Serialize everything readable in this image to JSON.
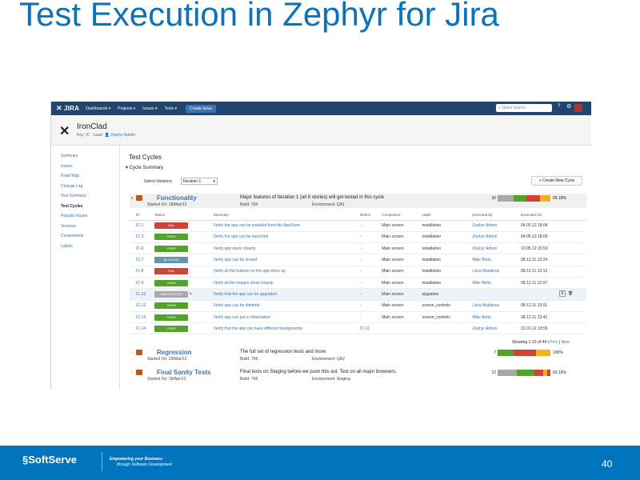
{
  "slide": {
    "title": "Test Execution in Zephyr for Jira",
    "page_number": "40"
  },
  "jira": {
    "logo": "JIRA",
    "nav": [
      "Dashboards ▾",
      "Projects ▾",
      "Issues ▾",
      "Tests ▾"
    ],
    "create_label": "Create issue",
    "search_placeholder": "Quick Search",
    "help_icon": "?",
    "gear_icon": "⚙"
  },
  "project": {
    "name": "IronClad",
    "key_label": "Key: IC",
    "lead_label": "Lead:",
    "lead_name": "Zephyr Admin"
  },
  "sidebar": {
    "items": [
      "Summary",
      "Issues",
      "Road Map",
      "Change Log",
      "Test Summary",
      "Test Cycles",
      "Popular Issues",
      "Versions",
      "Components",
      "Labels"
    ],
    "active_index": 5
  },
  "main": {
    "title": "Test Cycles",
    "section": "Cycle Summary",
    "select_label": "Select Versions:",
    "select_value": "Iteration 1",
    "new_cycle_label": "+ Create New Cycle"
  },
  "cycles": [
    {
      "name": "Functionality",
      "started": "Started On: 18/Mar/12",
      "build": "Build: 766",
      "environment": "Environment: QA1",
      "description": "Major features of Iteration 1 (all 8 stories) will get tested in this cycle",
      "count": "30",
      "percent": "68.18%",
      "segments": [
        {
          "color": "#a9a9a9",
          "value": 0.3
        },
        {
          "color": "#52a32c",
          "value": 0.25
        },
        {
          "color": "#d04437",
          "value": 0.25
        },
        {
          "color": "#f0b31e",
          "value": 0.2
        }
      ]
    },
    {
      "name": "Regression",
      "started": "Started On: 23/Mar/12",
      "build": "Build: 766",
      "environment": "Environment: QA2",
      "description": "The full set of regression tests and more",
      "count": "7",
      "percent": "100%",
      "segments": [
        {
          "color": "#52a32c",
          "value": 0.3
        },
        {
          "color": "#d04437",
          "value": 0.42
        },
        {
          "color": "#f0b31e",
          "value": 0.28
        }
      ]
    },
    {
      "name": "Final Sanity Tests",
      "started": "Started On: 18/Apr/12",
      "build": "Build: 766",
      "environment": "Environment: Staging",
      "description": "Final tests on Staging before we push this out. Test on all major browsers.",
      "count": "12",
      "percent": "63.16%",
      "segments": [
        {
          "color": "#a9a9a9",
          "value": 0.36
        },
        {
          "color": "#52a32c",
          "value": 0.34
        },
        {
          "color": "#d04437",
          "value": 0.16
        },
        {
          "color": "#f0b31e",
          "value": 0.08
        },
        {
          "color": "#d04437",
          "value": 0.06
        }
      ]
    }
  ],
  "executions": {
    "headers": [
      "ID",
      "Status",
      "Summary",
      "Defect",
      "Component",
      "Label",
      "Executed By",
      "Executed On"
    ],
    "rows": [
      {
        "id": "IC-1",
        "status": "FAIL",
        "color": "#d04437",
        "summary": "Verify the app can be installed from the AppStore",
        "defect": "-",
        "component": "Main screen",
        "label": "installation",
        "by": "Zephyr Admin",
        "on": "04.05.12 18:04"
      },
      {
        "id": "IC-3",
        "status": "PASS",
        "color": "#52a32c",
        "summary": "Verify the app can be launched",
        "defect": "-",
        "component": "Main screen",
        "label": "installation",
        "by": "Zephyr Admin",
        "on": "04.05.12 18:05"
      },
      {
        "id": "IC-6",
        "status": "PASS",
        "color": "#52a32c",
        "summary": "Verify app starts cleanly",
        "defect": "-",
        "component": "Main screen",
        "label": "installation",
        "by": "Zephyr Admin",
        "on": "10.05.12 15:53"
      },
      {
        "id": "IC-7",
        "status": "BLOCKED",
        "color": "#6693b0",
        "summary": "Verify app can be closed",
        "defect": "-",
        "component": "Main screen",
        "label": "installation",
        "by": "Mike Betts",
        "on": "08.12.11 12:24"
      },
      {
        "id": "IC-8",
        "status": "FAIL",
        "color": "#d04437",
        "summary": "Verify all the buttons on the app show up",
        "defect": "-",
        "component": "Main screen",
        "label": "installation",
        "by": "Lana Malakova",
        "on": "08.12.11 12:13"
      },
      {
        "id": "IC-9",
        "status": "PASS",
        "color": "#52a32c",
        "summary": "Verify all the images show cleanly",
        "defect": "-",
        "component": "Main screen",
        "label": "installation",
        "by": "Mike Betts",
        "on": "08.12.11 12:07"
      },
      {
        "id": "IC-10",
        "status": "UNEXECUTED",
        "color": "#a9a9a9",
        "summary": "Verify that the app can be upgraded",
        "defect": "-",
        "component": "Main screen",
        "label": "upgrades",
        "by": "",
        "on": ""
      },
      {
        "id": "IC-12",
        "status": "PASS",
        "color": "#52a32c",
        "summary": "Verify app can be dimmed",
        "defect": "-",
        "component": "Main screen",
        "label": "screen_controls",
        "by": "Lana Malakova",
        "on": "08.12.11 13:01"
      },
      {
        "id": "IC-13",
        "status": "PASS",
        "color": "#52a32c",
        "summary": "Verify app can put in hibernation",
        "defect": "-",
        "component": "Main screen",
        "label": "screen_controls",
        "by": "Mike Betts",
        "on": "08.12.11 13:41"
      },
      {
        "id": "IC-14",
        "status": "PASS",
        "color": "#52a32c",
        "summary": "Verify that the app can have different backgrounds",
        "defect": "IC-11",
        "component": "",
        "label": "",
        "by": "Zephyr Admin",
        "on": "21.01.12 19:56"
      }
    ],
    "paging_text": "Showing 1-10 of 44 |",
    "prev_label": "Prev",
    "next_label": "Next"
  },
  "footer": {
    "brand": "SoftServe",
    "tagline1": "Empowering your Business",
    "tagline2": "through Software Development"
  }
}
